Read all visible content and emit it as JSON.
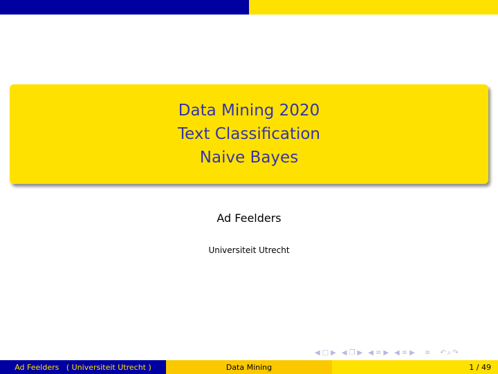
{
  "slide": {
    "title_lines": [
      "Data Mining 2020",
      "Text Classification",
      "Naive Bayes"
    ],
    "author": "Ad Feelders",
    "institute": "Universiteit Utrecht"
  },
  "footer": {
    "author_institute": "Ad Feelders   ( Universiteit Utrecht )",
    "short_title": "Data Mining",
    "page_number": "1 / 49"
  },
  "navigation": {
    "icons": [
      "frame-prev-icon",
      "frame-icon",
      "frame-next-icon",
      "subsection-prev-icon",
      "subsection-icon",
      "subsection-next-icon",
      "section-prev-icon",
      "section-icon",
      "section-next-icon",
      "document-prev-icon",
      "document-icon",
      "document-next-icon",
      "alignment-icon",
      "back-icon",
      "search-icon",
      "forward-icon"
    ]
  },
  "colors": {
    "blue": "#0000a0",
    "yellow": "#ffe100",
    "orange_yellow": "#fbc800",
    "title_text": "#3535a8"
  }
}
